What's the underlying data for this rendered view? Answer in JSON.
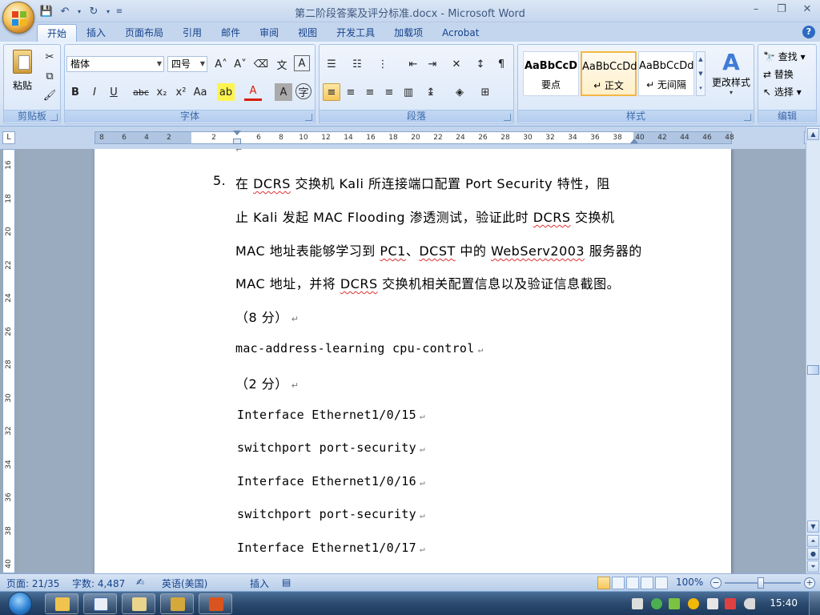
{
  "window": {
    "title": "第二阶段答案及评分标准.docx - Microsoft Word"
  },
  "ribbon": {
    "tabs": [
      "开始",
      "插入",
      "页面布局",
      "引用",
      "邮件",
      "审阅",
      "视图",
      "开发工具",
      "加载项",
      "Acrobat"
    ],
    "active_tab": "开始",
    "clipboard": {
      "label": "剪贴板",
      "paste": "粘贴"
    },
    "font": {
      "label": "字体",
      "font_name": "楷体",
      "font_size": "四号"
    },
    "paragraph": {
      "label": "段落"
    },
    "styles": {
      "label": "样式",
      "items": [
        {
          "sample": "AaBbCcD",
          "name": "要点"
        },
        {
          "sample": "AaBbCcDd",
          "name": "↵ 正文"
        },
        {
          "sample": "AaBbCcDd",
          "name": "↵ 无间隔"
        }
      ],
      "change_styles": "更改样式"
    },
    "editing": {
      "label": "编辑",
      "find": "查找",
      "replace": "替换",
      "select": "选择"
    }
  },
  "ruler": {
    "ticks": [
      "8",
      "6",
      "4",
      "2",
      "",
      "2",
      "",
      "6",
      "8",
      "10",
      "12",
      "14",
      "16",
      "18",
      "20",
      "22",
      "24",
      "26",
      "28",
      "30",
      "32",
      "34",
      "36",
      "38",
      "40",
      "42",
      "44",
      "46",
      "48"
    ],
    "vticks": [
      "16",
      "18",
      "20",
      "22",
      "24",
      "26",
      "28",
      "30",
      "32",
      "34",
      "36",
      "38",
      "40"
    ]
  },
  "document": {
    "list_number": "5.",
    "lines": [
      "在 DCRS 交换机 Kali 所连接端口配置 Port Security 特性，阻",
      "止 Kali 发起 MAC Flooding 渗透测试，验证此时 DCRS 交换机",
      "MAC 地址表能够学习到 PC1、DCST 中的 WebServ2003 服务器的",
      "MAC 地址，并将 DCRS 交换机相关配置信息以及验证信息截图。",
      "（8 分）",
      "mac-address-learning cpu-control",
      "（2 分）",
      "Interface Ethernet1/0/15",
      " switchport port-security",
      "Interface Ethernet1/0/16",
      " switchport port-security",
      "Interface Ethernet1/0/17"
    ]
  },
  "status": {
    "page": "页面: 21/35",
    "words": "字数: 4,487",
    "language": "英语(美国)",
    "insert_mode": "插入",
    "zoom": "100%"
  },
  "taskbar": {
    "clock": "15:40"
  },
  "colors": {
    "accent": "#15428b",
    "ribbon_bg": "#dbe7f7",
    "squiggle": "#e03131"
  }
}
